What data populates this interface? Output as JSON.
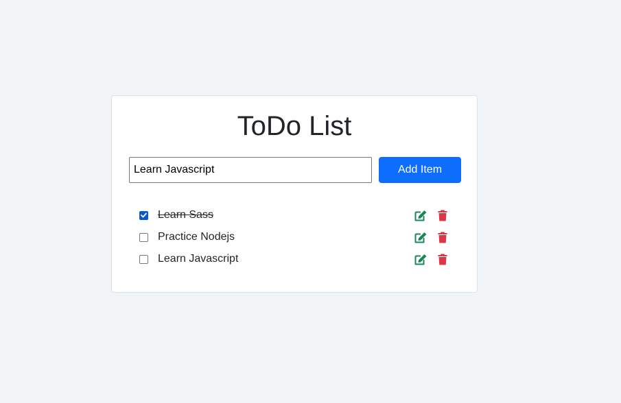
{
  "header": {
    "title": "ToDo List"
  },
  "form": {
    "input_value": "Learn Javascript",
    "add_button_label": "Add Item"
  },
  "todos": [
    {
      "label": "Learn Sass",
      "done": true
    },
    {
      "label": "Practice Nodejs",
      "done": false
    },
    {
      "label": "Learn Javascript",
      "done": false
    }
  ],
  "icons": {
    "edit": "edit-icon",
    "delete": "trash-icon"
  },
  "colors": {
    "page_background": "#f1f4f7",
    "primary": "#0d6efd",
    "checkbox_checked": "#0b57d0",
    "edit": "#198754",
    "delete": "#dc3545"
  }
}
